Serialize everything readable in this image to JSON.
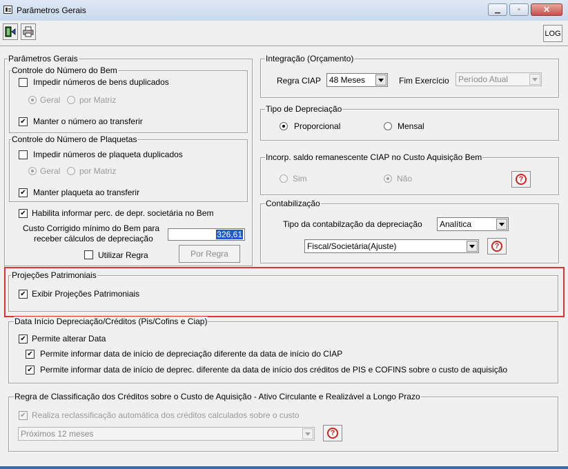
{
  "window": {
    "title": "Parâmetros Gerais",
    "controls": [
      "minimize",
      "maximize",
      "close"
    ]
  },
  "toolbar": {
    "exit_icon": "exit-door-icon",
    "print_icon": "printer-icon",
    "log_label": "LOG"
  },
  "parametros_gerais": {
    "legend": "Parâmetros Gerais",
    "controle_bem": {
      "legend": "Controle do Número do Bem",
      "impedir_label": "Impedir números de bens duplicados",
      "impedir_checked": false,
      "geral_label": "Geral",
      "por_matriz_label": "por Matriz",
      "manter_label": "Manter o número ao transferir",
      "manter_checked": true
    },
    "controle_plaquetas": {
      "legend": "Controle do Número de Plaquetas",
      "impedir_label": "Impedir números de plaqueta duplicados",
      "impedir_checked": false,
      "geral_label": "Geral",
      "por_matriz_label": "por Matriz",
      "manter_label": "Manter plaqueta ao transferir",
      "manter_checked": true
    },
    "habilita_label": "Habilita informar perc. de depr. societária no Bem",
    "habilita_checked": true,
    "custo_label_1": "Custo Corrigido mínimo do Bem para",
    "custo_label_2": "receber cálculos de depreciação",
    "custo_value": "326,61",
    "utilizar_regra_label": "Utilizar Regra",
    "utilizar_regra_checked": false,
    "por_regra_label": "Por Regra"
  },
  "integracao": {
    "legend": "Integração (Orçamento)",
    "regra_ciap_label": "Regra CIAP",
    "regra_ciap_value": "48 Meses",
    "fim_exercicio_label": "Fim Exercício",
    "fim_exercicio_value": "Período Atual"
  },
  "tipo_depreciacao": {
    "legend": "Tipo de Depreciação",
    "proporcional_label": "Proporcional",
    "mensal_label": "Mensal",
    "selected": "Proporcional"
  },
  "incorp_saldo": {
    "legend": "Incorp. saldo remanescente CIAP no Custo Aquisição Bem",
    "sim_label": "Sim",
    "nao_label": "Não",
    "selected": "Não"
  },
  "contabilizacao": {
    "legend": "Contabilização",
    "tipo_label": "Tipo da contabilzação da depreciação",
    "tipo_value": "Analítica",
    "fiscal_value": "Fiscal/Societária(Ajuste)"
  },
  "projecoes": {
    "legend": "Projeções Patrimoniais",
    "exibir_label": "Exibir Projeções Patrimoniais",
    "exibir_checked": true
  },
  "data_inicio": {
    "legend": "Data Início Depreciação/Créditos (Pis/Cofins e Ciap)",
    "permite_alterar_label": "Permite alterar Data",
    "permite_alterar_checked": true,
    "permite_ciap_label": "Permite informar data de início de depreciação diferente da data de início do CIAP",
    "permite_ciap_checked": true,
    "permite_pis_label": "Permite informar data de início de deprec. diferente da data de início dos créditos de PIS e COFINS sobre o custo de aquisição",
    "permite_pis_checked": true
  },
  "regra_classificacao": {
    "legend": "Regra de Classificação dos Créditos sobre o Custo de Aquisição - Ativo Circulante e Realizável a Longo Prazo",
    "realiza_label": "Realiza reclassificação automática dos créditos calculados sobre o custo",
    "realiza_checked": true,
    "periodo_value": "Próximos 12 meses"
  },
  "help_label": "?",
  "colors": {
    "highlight": "#e03131",
    "help_red": "#d02020",
    "selection_blue": "#1e5bc6"
  }
}
